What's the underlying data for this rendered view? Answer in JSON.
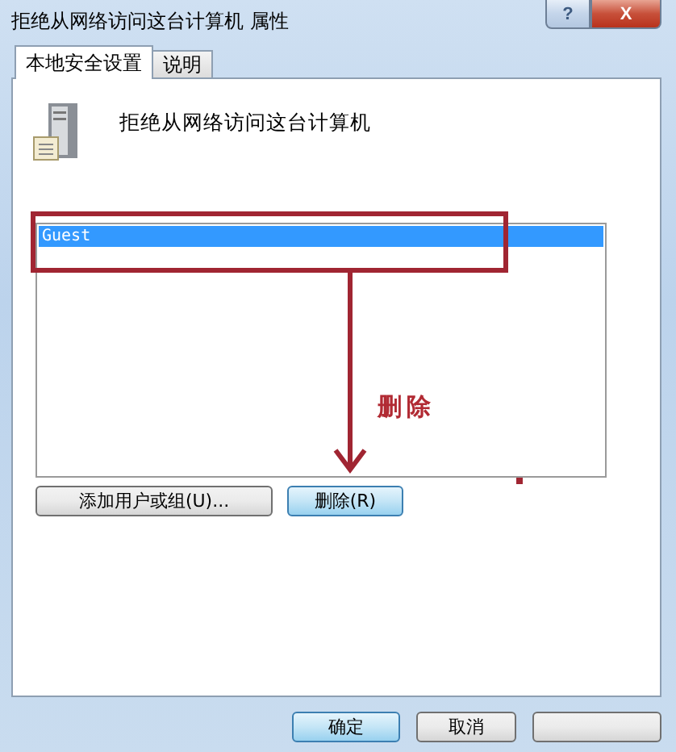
{
  "window": {
    "title": "拒绝从网络访问这台计算机 属性",
    "help": "?",
    "close": "X"
  },
  "tabs": [
    {
      "label": "本地安全设置",
      "selected": true
    },
    {
      "label": "说明",
      "selected": false
    }
  ],
  "policy": {
    "name": "拒绝从网络访问这台计算机"
  },
  "members": [
    {
      "name": "Guest",
      "selected": true
    }
  ],
  "annotation": {
    "label": "删除"
  },
  "list_buttons": [
    {
      "label": "添加用户或组(U)...",
      "focused": false
    },
    {
      "label": "删除(R)",
      "focused": true
    }
  ],
  "buttons": [
    {
      "label": "确定",
      "focused": true
    },
    {
      "label": "取消",
      "focused": false
    },
    {
      "focused": false
    }
  ]
}
